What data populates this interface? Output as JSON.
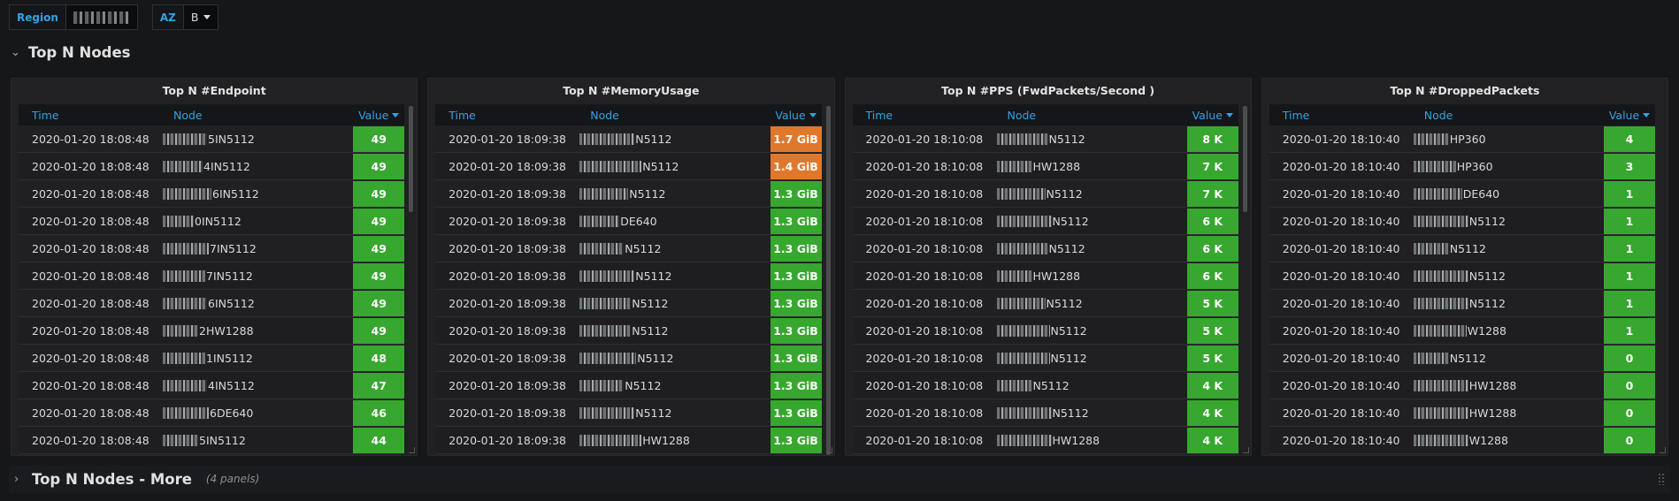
{
  "variables": {
    "region": {
      "label": "Region"
    },
    "az": {
      "label": "AZ",
      "value": "B"
    }
  },
  "rows": [
    {
      "title": "Top N Nodes"
    },
    {
      "title": "Top N Nodes - More",
      "meta": "(4 panels)"
    }
  ],
  "table_headers": {
    "time": "Time",
    "node": "Node",
    "value": "Value"
  },
  "panels": [
    {
      "title": "Top N #Endpoint",
      "rows": [
        {
          "time": "2020-01-20 18:08:48",
          "node_suffix": "5IN5112",
          "value": "49",
          "color": "green"
        },
        {
          "time": "2020-01-20 18:08:48",
          "node_suffix": "4IN5112",
          "value": "49",
          "color": "green"
        },
        {
          "time": "2020-01-20 18:08:48",
          "node_suffix": "6IN5112",
          "value": "49",
          "color": "green"
        },
        {
          "time": "2020-01-20 18:08:48",
          "node_suffix": "0IN5112",
          "value": "49",
          "color": "green"
        },
        {
          "time": "2020-01-20 18:08:48",
          "node_suffix": "7IN5112",
          "value": "49",
          "color": "green"
        },
        {
          "time": "2020-01-20 18:08:48",
          "node_suffix": "7IN5112",
          "value": "49",
          "color": "green"
        },
        {
          "time": "2020-01-20 18:08:48",
          "node_suffix": "6IN5112",
          "value": "49",
          "color": "green"
        },
        {
          "time": "2020-01-20 18:08:48",
          "node_suffix": "2HW1288",
          "value": "49",
          "color": "green"
        },
        {
          "time": "2020-01-20 18:08:48",
          "node_suffix": "1IN5112",
          "value": "48",
          "color": "green"
        },
        {
          "time": "2020-01-20 18:08:48",
          "node_suffix": "4IN5112",
          "value": "47",
          "color": "green"
        },
        {
          "time": "2020-01-20 18:08:48",
          "node_suffix": "6DE640",
          "value": "46",
          "color": "green"
        },
        {
          "time": "2020-01-20 18:08:48",
          "node_suffix": "5IN5112",
          "value": "44",
          "color": "green"
        }
      ]
    },
    {
      "title": "Top N #MemoryUsage",
      "rows": [
        {
          "time": "2020-01-20 18:09:38",
          "node_suffix": "N5112",
          "value": "1.7 GiB",
          "color": "orange"
        },
        {
          "time": "2020-01-20 18:09:38",
          "node_suffix": "N5112",
          "value": "1.4 GiB",
          "color": "orange"
        },
        {
          "time": "2020-01-20 18:09:38",
          "node_suffix": "N5112",
          "value": "1.3 GiB",
          "color": "green"
        },
        {
          "time": "2020-01-20 18:09:38",
          "node_suffix": "DE640",
          "value": "1.3 GiB",
          "color": "green"
        },
        {
          "time": "2020-01-20 18:09:38",
          "node_suffix": "N5112",
          "value": "1.3 GiB",
          "color": "green"
        },
        {
          "time": "2020-01-20 18:09:38",
          "node_suffix": "N5112",
          "value": "1.3 GiB",
          "color": "green"
        },
        {
          "time": "2020-01-20 18:09:38",
          "node_suffix": "N5112",
          "value": "1.3 GiB",
          "color": "green"
        },
        {
          "time": "2020-01-20 18:09:38",
          "node_suffix": "N5112",
          "value": "1.3 GiB",
          "color": "green"
        },
        {
          "time": "2020-01-20 18:09:38",
          "node_suffix": "N5112",
          "value": "1.3 GiB",
          "color": "green"
        },
        {
          "time": "2020-01-20 18:09:38",
          "node_suffix": "N5112",
          "value": "1.3 GiB",
          "color": "green"
        },
        {
          "time": "2020-01-20 18:09:38",
          "node_suffix": "N5112",
          "value": "1.3 GiB",
          "color": "green"
        },
        {
          "time": "2020-01-20 18:09:38",
          "node_suffix": "HW1288",
          "value": "1.3 GiB",
          "color": "green"
        }
      ]
    },
    {
      "title": "Top N #PPS (FwdPackets/Second )",
      "rows": [
        {
          "time": "2020-01-20 18:10:08",
          "node_suffix": "N5112",
          "value": "8 K",
          "color": "green"
        },
        {
          "time": "2020-01-20 18:10:08",
          "node_suffix": "HW1288",
          "value": "7 K",
          "color": "green"
        },
        {
          "time": "2020-01-20 18:10:08",
          "node_suffix": "N5112",
          "value": "7 K",
          "color": "green"
        },
        {
          "time": "2020-01-20 18:10:08",
          "node_suffix": "N5112",
          "value": "6 K",
          "color": "green"
        },
        {
          "time": "2020-01-20 18:10:08",
          "node_suffix": "N5112",
          "value": "6 K",
          "color": "green"
        },
        {
          "time": "2020-01-20 18:10:08",
          "node_suffix": "HW1288",
          "value": "6 K",
          "color": "green"
        },
        {
          "time": "2020-01-20 18:10:08",
          "node_suffix": "N5112",
          "value": "5 K",
          "color": "green"
        },
        {
          "time": "2020-01-20 18:10:08",
          "node_suffix": "N5112",
          "value": "5 K",
          "color": "green"
        },
        {
          "time": "2020-01-20 18:10:08",
          "node_suffix": "N5112",
          "value": "5 K",
          "color": "green"
        },
        {
          "time": "2020-01-20 18:10:08",
          "node_suffix": "N5112",
          "value": "4 K",
          "color": "green"
        },
        {
          "time": "2020-01-20 18:10:08",
          "node_suffix": "N5112",
          "value": "4 K",
          "color": "green"
        },
        {
          "time": "2020-01-20 18:10:08",
          "node_suffix": "HW1288",
          "value": "4 K",
          "color": "green"
        }
      ]
    },
    {
      "title": "Top N #DroppedPackets",
      "rows": [
        {
          "time": "2020-01-20 18:10:40",
          "node_suffix": "HP360",
          "value": "4",
          "color": "green"
        },
        {
          "time": "2020-01-20 18:10:40",
          "node_suffix": "HP360",
          "value": "3",
          "color": "green"
        },
        {
          "time": "2020-01-20 18:10:40",
          "node_suffix": "DE640",
          "value": "1",
          "color": "green"
        },
        {
          "time": "2020-01-20 18:10:40",
          "node_suffix": "N5112",
          "value": "1",
          "color": "green"
        },
        {
          "time": "2020-01-20 18:10:40",
          "node_suffix": "N5112",
          "value": "1",
          "color": "green"
        },
        {
          "time": "2020-01-20 18:10:40",
          "node_suffix": "N5112",
          "value": "1",
          "color": "green"
        },
        {
          "time": "2020-01-20 18:10:40",
          "node_suffix": "N5112",
          "value": "1",
          "color": "green"
        },
        {
          "time": "2020-01-20 18:10:40",
          "node_suffix": "W1288",
          "value": "1",
          "color": "green"
        },
        {
          "time": "2020-01-20 18:10:40",
          "node_suffix": "N5112",
          "value": "0",
          "color": "green"
        },
        {
          "time": "2020-01-20 18:10:40",
          "node_suffix": "HW1288",
          "value": "0",
          "color": "green"
        },
        {
          "time": "2020-01-20 18:10:40",
          "node_suffix": "HW1288",
          "value": "0",
          "color": "green"
        },
        {
          "time": "2020-01-20 18:10:40",
          "node_suffix": "W1288",
          "value": "0",
          "color": "green"
        }
      ]
    }
  ],
  "colors": {
    "green": "#37a72f",
    "orange": "#e0782c",
    "accent": "#33a2e5"
  }
}
